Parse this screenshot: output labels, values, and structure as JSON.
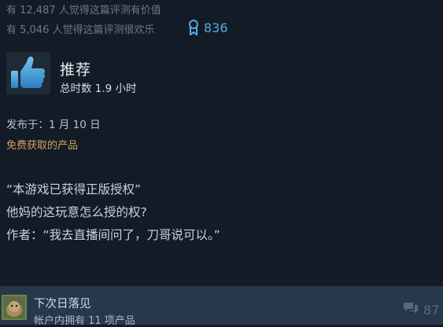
{
  "review": {
    "helpful_line": "有 12,487 人觉得这篇评测有价值",
    "funny_line": "有 5,046 人觉得这篇评测很欢乐",
    "award_count": "836",
    "recommendation": "推荐",
    "hours": "总时数 1.9 小时",
    "posted": "发布于：1 月 10 日",
    "free_product": "免费获取的产品",
    "body_lines": [
      "“本游戏已获得正版授权”",
      "他妈的这玩意怎么授的权?",
      "作者：“我去直播间问了，刀哥说可以。”"
    ]
  },
  "author": {
    "name": "下次日落见",
    "products": "帐户内拥有 11 项产品",
    "comment_count": "87"
  },
  "icons": {
    "award": "award-ribbon-icon",
    "thumb": "thumbs-up-icon",
    "comment": "comment-bubble-icon"
  },
  "colors": {
    "background": "#131b27",
    "accent_blue": "#5aa9e6",
    "free_label": "#d4a256",
    "author_bar": "#27384c"
  }
}
